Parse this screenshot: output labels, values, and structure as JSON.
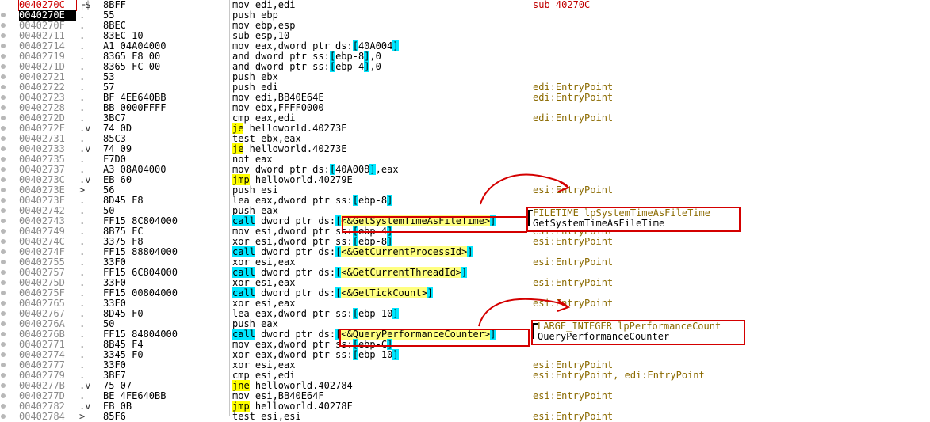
{
  "rows": [
    {
      "addr": "0040270C",
      "jump": "┌$",
      "bytes": "8BFF",
      "instr": "mov edi,edi",
      "comment": "sub_40270C",
      "cur": false,
      "eip": true
    },
    {
      "addr": "0040270E",
      "jump": ".",
      "bytes": "55",
      "instr": "push ebp",
      "comment": "",
      "cur": true
    },
    {
      "addr": "0040270F",
      "jump": ".",
      "bytes": "8BEC",
      "instr": "mov ebp,esp",
      "comment": ""
    },
    {
      "addr": "00402711",
      "jump": ".",
      "bytes": "83EC 10",
      "instr": "sub esp,10",
      "comment": ""
    },
    {
      "addr": "00402714",
      "jump": ".",
      "bytes": "A1 04A04000",
      "instr": "mov eax,dword ptr ds:[40A004]",
      "comment": ""
    },
    {
      "addr": "00402719",
      "jump": ".",
      "bytes": "8365 F8 00",
      "instr": "and dword ptr ss:[ebp-8],0",
      "comment": ""
    },
    {
      "addr": "0040271D",
      "jump": ".",
      "bytes": "8365 FC 00",
      "instr": "and dword ptr ss:[ebp-4],0",
      "comment": ""
    },
    {
      "addr": "00402721",
      "jump": ".",
      "bytes": "53",
      "instr": "push ebx",
      "comment": ""
    },
    {
      "addr": "00402722",
      "jump": ".",
      "bytes": "57",
      "instr": "push edi",
      "comment": "edi:EntryPoint"
    },
    {
      "addr": "00402723",
      "jump": ".",
      "bytes": "BF 4EE640BB",
      "instr": "mov edi,BB40E64E",
      "comment": "edi:EntryPoint"
    },
    {
      "addr": "00402728",
      "jump": ".",
      "bytes": "BB 0000FFFF",
      "instr": "mov ebx,FFFF0000",
      "comment": ""
    },
    {
      "addr": "0040272D",
      "jump": ".",
      "bytes": "3BC7",
      "instr": "cmp eax,edi",
      "comment": "edi:EntryPoint"
    },
    {
      "addr": "0040272F",
      "jump": ".v",
      "bytes": "74 0D",
      "instr": "je helloworld.40273E",
      "comment": ""
    },
    {
      "addr": "00402731",
      "jump": ".",
      "bytes": "85C3",
      "instr": "test ebx,eax",
      "comment": ""
    },
    {
      "addr": "00402733",
      "jump": ".v",
      "bytes": "74 09",
      "instr": "je helloworld.40273E",
      "comment": ""
    },
    {
      "addr": "00402735",
      "jump": ".",
      "bytes": "F7D0",
      "instr": "not eax",
      "comment": ""
    },
    {
      "addr": "00402737",
      "jump": ".",
      "bytes": "A3 08A04000",
      "instr": "mov dword ptr ds:[40A008],eax",
      "comment": ""
    },
    {
      "addr": "0040273C",
      "jump": ".v",
      "bytes": "EB 60",
      "instr": "jmp helloworld.40279E",
      "comment": ""
    },
    {
      "addr": "0040273E",
      "jump": ">",
      "bytes": "56",
      "instr": "push esi",
      "comment": "esi:EntryPoint"
    },
    {
      "addr": "0040273F",
      "jump": ".",
      "bytes": "8D45 F8",
      "instr": "lea eax,dword ptr ss:[ebp-8]",
      "comment": ""
    },
    {
      "addr": "00402742",
      "jump": ".",
      "bytes": "50",
      "instr": "push eax",
      "comment": ""
    },
    {
      "addr": "00402743",
      "jump": ".",
      "bytes": "FF15 8C804000",
      "instr": "call dword ptr ds:[<&GetSystemTimeAsFileTime>]",
      "comment": ""
    },
    {
      "addr": "00402749",
      "jump": ".",
      "bytes": "8B75 FC",
      "instr": "mov esi,dword ptr ss:[ebp-4]",
      "comment": "esi:EntryPoint"
    },
    {
      "addr": "0040274C",
      "jump": ".",
      "bytes": "3375 F8",
      "instr": "xor esi,dword ptr ss:[ebp-8]",
      "comment": "esi:EntryPoint"
    },
    {
      "addr": "0040274F",
      "jump": ".",
      "bytes": "FF15 88804000",
      "instr": "call dword ptr ds:[<&GetCurrentProcessId>]",
      "comment": ""
    },
    {
      "addr": "00402755",
      "jump": ".",
      "bytes": "33F0",
      "instr": "xor esi,eax",
      "comment": "esi:EntryPoint"
    },
    {
      "addr": "00402757",
      "jump": ".",
      "bytes": "FF15 6C804000",
      "instr": "call dword ptr ds:[<&GetCurrentThreadId>]",
      "comment": ""
    },
    {
      "addr": "0040275D",
      "jump": ".",
      "bytes": "33F0",
      "instr": "xor esi,eax",
      "comment": "esi:EntryPoint"
    },
    {
      "addr": "0040275F",
      "jump": ".",
      "bytes": "FF15 00804000",
      "instr": "call dword ptr ds:[<&GetTickCount>]",
      "comment": ""
    },
    {
      "addr": "00402765",
      "jump": ".",
      "bytes": "33F0",
      "instr": "xor esi,eax",
      "comment": "esi:EntryPoint"
    },
    {
      "addr": "00402767",
      "jump": ".",
      "bytes": "8D45 F0",
      "instr": "lea eax,dword ptr ss:[ebp-10]",
      "comment": ""
    },
    {
      "addr": "0040276A",
      "jump": ".",
      "bytes": "50",
      "instr": "push eax",
      "comment": ""
    },
    {
      "addr": "0040276B",
      "jump": ".",
      "bytes": "FF15 84804000",
      "instr": "call dword ptr ds:[<&QueryPerformanceCounter>]",
      "comment": ""
    },
    {
      "addr": "00402771",
      "jump": ".",
      "bytes": "8B45 F4",
      "instr": "mov eax,dword ptr ss:[ebp-C]",
      "comment": ""
    },
    {
      "addr": "00402774",
      "jump": ".",
      "bytes": "3345 F0",
      "instr": "xor eax,dword ptr ss:[ebp-10]",
      "comment": ""
    },
    {
      "addr": "00402777",
      "jump": ".",
      "bytes": "33F0",
      "instr": "xor esi,eax",
      "comment": "esi:EntryPoint"
    },
    {
      "addr": "00402779",
      "jump": ".",
      "bytes": "3BF7",
      "instr": "cmp esi,edi",
      "comment": "esi:EntryPoint, edi:EntryPoint"
    },
    {
      "addr": "0040277B",
      "jump": ".v",
      "bytes": "75 07",
      "instr": "jne helloworld.402784",
      "comment": ""
    },
    {
      "addr": "0040277D",
      "jump": ".",
      "bytes": "BE 4FE640BB",
      "instr": "mov esi,BB40E64F",
      "comment": "esi:EntryPoint"
    },
    {
      "addr": "00402782",
      "jump": ".v",
      "bytes": "EB 0B",
      "instr": "jmp helloworld.40278F",
      "comment": ""
    },
    {
      "addr": "00402784",
      "jump": ">",
      "bytes": "85F6",
      "instr": "test esi,esi",
      "comment": "esi:EntryPoint"
    }
  ],
  "annotations": {
    "systime_args": {
      "line1": "FILETIME lpSystemTimeAsFileTime",
      "line2": "GetSystemTimeAsFileTime"
    },
    "qpc_args": {
      "line1": "LARGE_INTEGER lpPerformanceCount",
      "line2": "QueryPerformanceCounter"
    }
  },
  "colors": {
    "call_highlight": "#00e6ff",
    "jump_highlight": "#ffff00",
    "annotation_red": "#d40000",
    "comment": "#8b6a00",
    "function_label": "#c00000"
  }
}
